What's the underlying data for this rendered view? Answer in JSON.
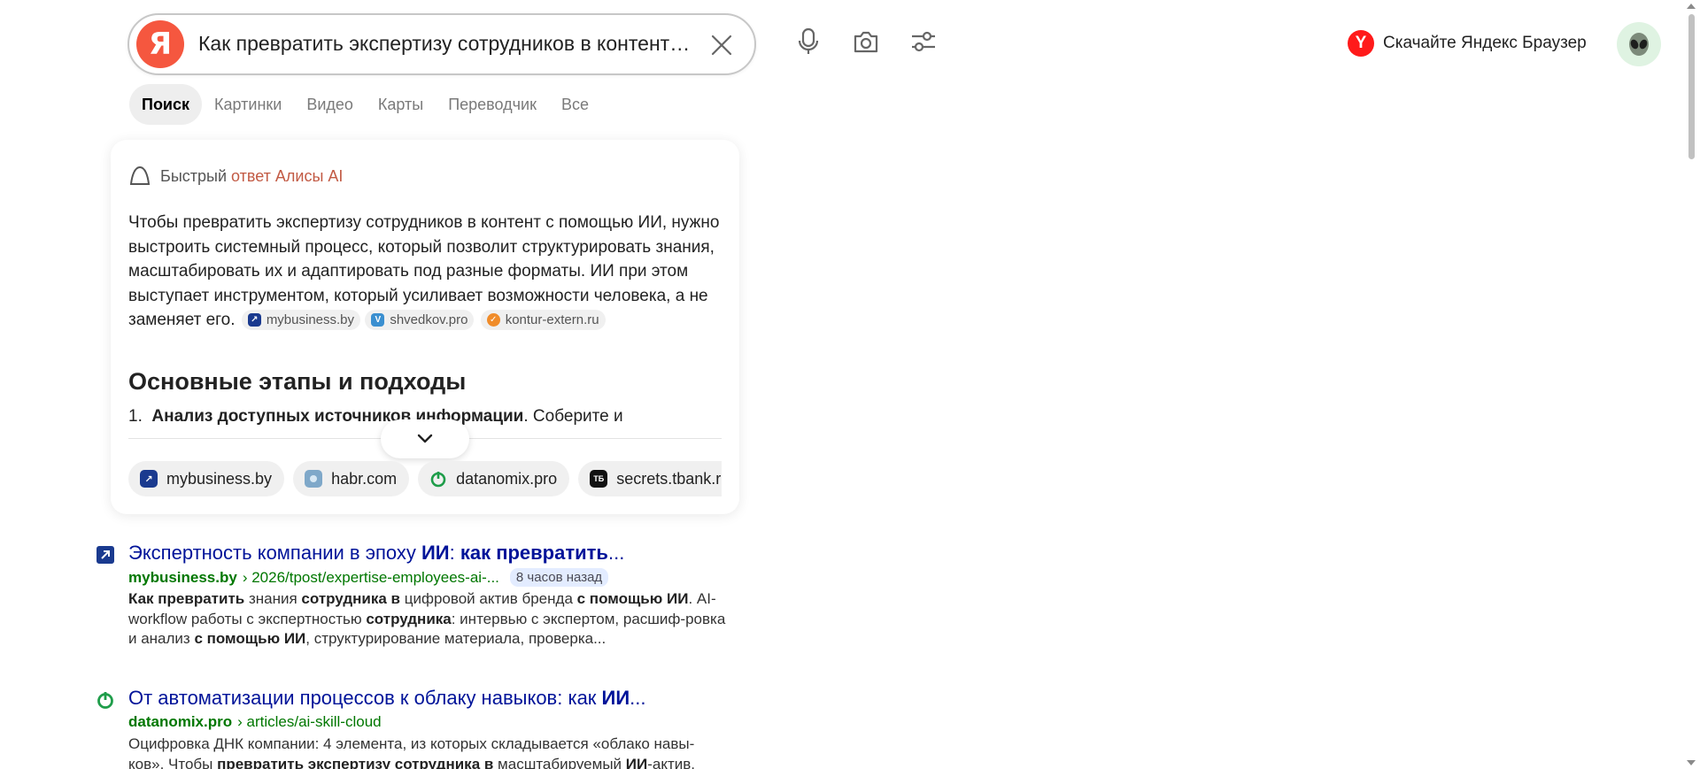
{
  "search": {
    "logo_letter": "Я",
    "query": "Как превратить экспертизу сотрудников в контент с помощью ИИ"
  },
  "promo": {
    "label": "Скачайте Яндекс Браузер",
    "logo_letter": "Y"
  },
  "tabs": [
    {
      "label": "Поиск",
      "active": true
    },
    {
      "label": "Картинки"
    },
    {
      "label": "Видео"
    },
    {
      "label": "Карты"
    },
    {
      "label": "Переводчик"
    },
    {
      "label": "Все"
    }
  ],
  "alice": {
    "head_gray": "Быстрый",
    "head_accent": "ответ Алисы AI",
    "paragraph": "Чтобы превратить экспертизу сотрудников в контент с помощью ИИ, нужно выстроить системный процесс, который позволит структурировать знания, масштабировать их и адаптировать под разные форматы. ИИ при этом выступает инструментом, который усиливает возможности человека, а не заменяет его.",
    "inline_sources": [
      "mybusiness.by",
      "shvedkov.pro",
      "kontur-extern.ru"
    ],
    "heading": "Основные этапы и подходы",
    "step_number": "1.",
    "step_bold": "Анализ доступных источников информации",
    "step_rest": ". Соберите и",
    "sources": [
      {
        "label": "mybusiness.by",
        "color": "#1a3a8f",
        "glyph": "↗"
      },
      {
        "label": "habr.com",
        "color": "#7fa8c9",
        "glyph": ""
      },
      {
        "label": "datanomix.pro",
        "color": "#1f9d4a",
        "glyph": ""
      },
      {
        "label": "secrets.tbank.ru",
        "color": "#111111",
        "glyph": "ТБ"
      }
    ]
  },
  "results": [
    {
      "title_plain": "Экспертность компании в эпоху ",
      "title_bold1": "ИИ",
      "title_mid": ": ",
      "title_bold2": "как превратить",
      "title_end": "...",
      "host": "mybusiness.by",
      "path": "› 2026/tpost/expertise-employees-ai-...",
      "badge": "8 часов назад",
      "snippet": [
        {
          "b": "Как превратить"
        },
        {
          "t": " знания "
        },
        {
          "b": "сотрудника в"
        },
        {
          "t": " цифровой актив бренда "
        },
        {
          "b": "с помощью ИИ"
        },
        {
          "t": ". AI-workflow работы с экспертностью "
        },
        {
          "b": "сотрудника"
        },
        {
          "t": ": интервью с экспертом, расшиф-ровка и анализ "
        },
        {
          "b": "с помощью ИИ"
        },
        {
          "t": ", структурирование материала, проверка..."
        }
      ]
    },
    {
      "title_plain": "От автоматизации процессов к облаку навыков: как ",
      "title_bold1": "ИИ",
      "title_mid": "",
      "title_bold2": "",
      "title_end": "...",
      "host": "datanomix.pro",
      "path": "› articles/ai-skill-cloud",
      "badge": "",
      "snippet": [
        {
          "t": "Оцифровка ДНК компании: 4 элемента, из которых складывается «облако навы-ков». Чтобы "
        },
        {
          "b": "превратить экспертизу сотрудника в"
        },
        {
          "t": " масштабируемый "
        },
        {
          "b": "ИИ"
        },
        {
          "t": "-актив,"
        }
      ]
    }
  ],
  "colors": {
    "accent": "#c25a44",
    "link": "#001399",
    "url": "#007700",
    "yandex_red": "#f5573f"
  }
}
